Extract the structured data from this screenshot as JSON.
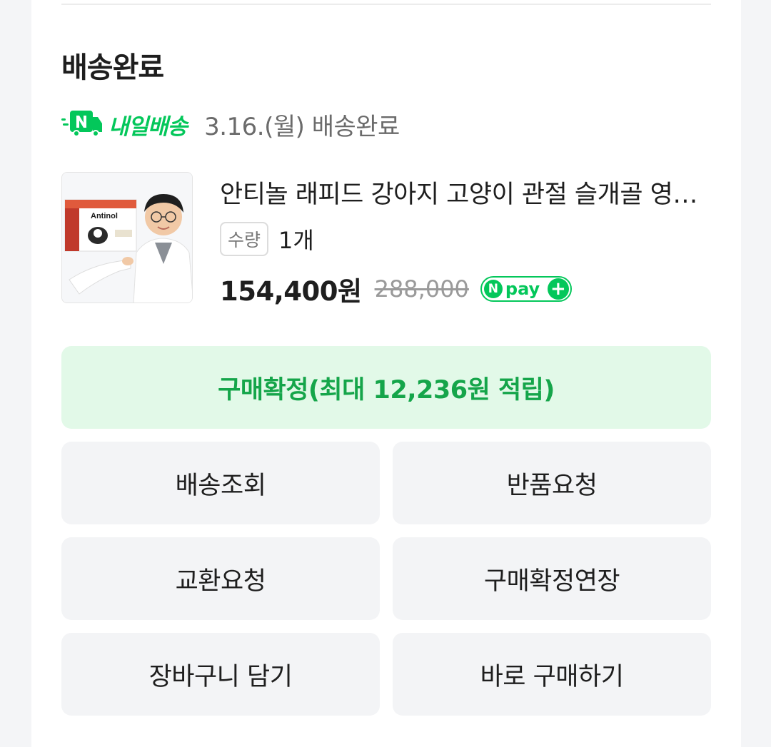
{
  "order": {
    "status_title": "배송완료",
    "delivery_badge": "내일배송",
    "delivery_badge_icon": "truck-n-icon",
    "delivery_badge_color": "#03C75A",
    "delivery_date_status": "3.16.(월) 배송완료"
  },
  "product": {
    "name": "안티놀 래피드 강아지 고양이 관절 슬개골 영양제",
    "image_text": "Antinol",
    "qty_label": "수량",
    "qty_value": "1개",
    "sale_price": "154,400원",
    "original_price": "288,000",
    "npay_badge": {
      "n": "N",
      "text": "pay",
      "plus": "+"
    }
  },
  "confirm_button": {
    "label": "구매확정(최대 12,236원 적립)",
    "color": "#15A54A",
    "background": "#E2F9E8"
  },
  "actions": [
    {
      "label": "배송조회"
    },
    {
      "label": "반품요청"
    },
    {
      "label": "교환요청"
    },
    {
      "label": "구매확정연장"
    },
    {
      "label": "장바구니 담기"
    },
    {
      "label": "바로 구매하기"
    }
  ]
}
